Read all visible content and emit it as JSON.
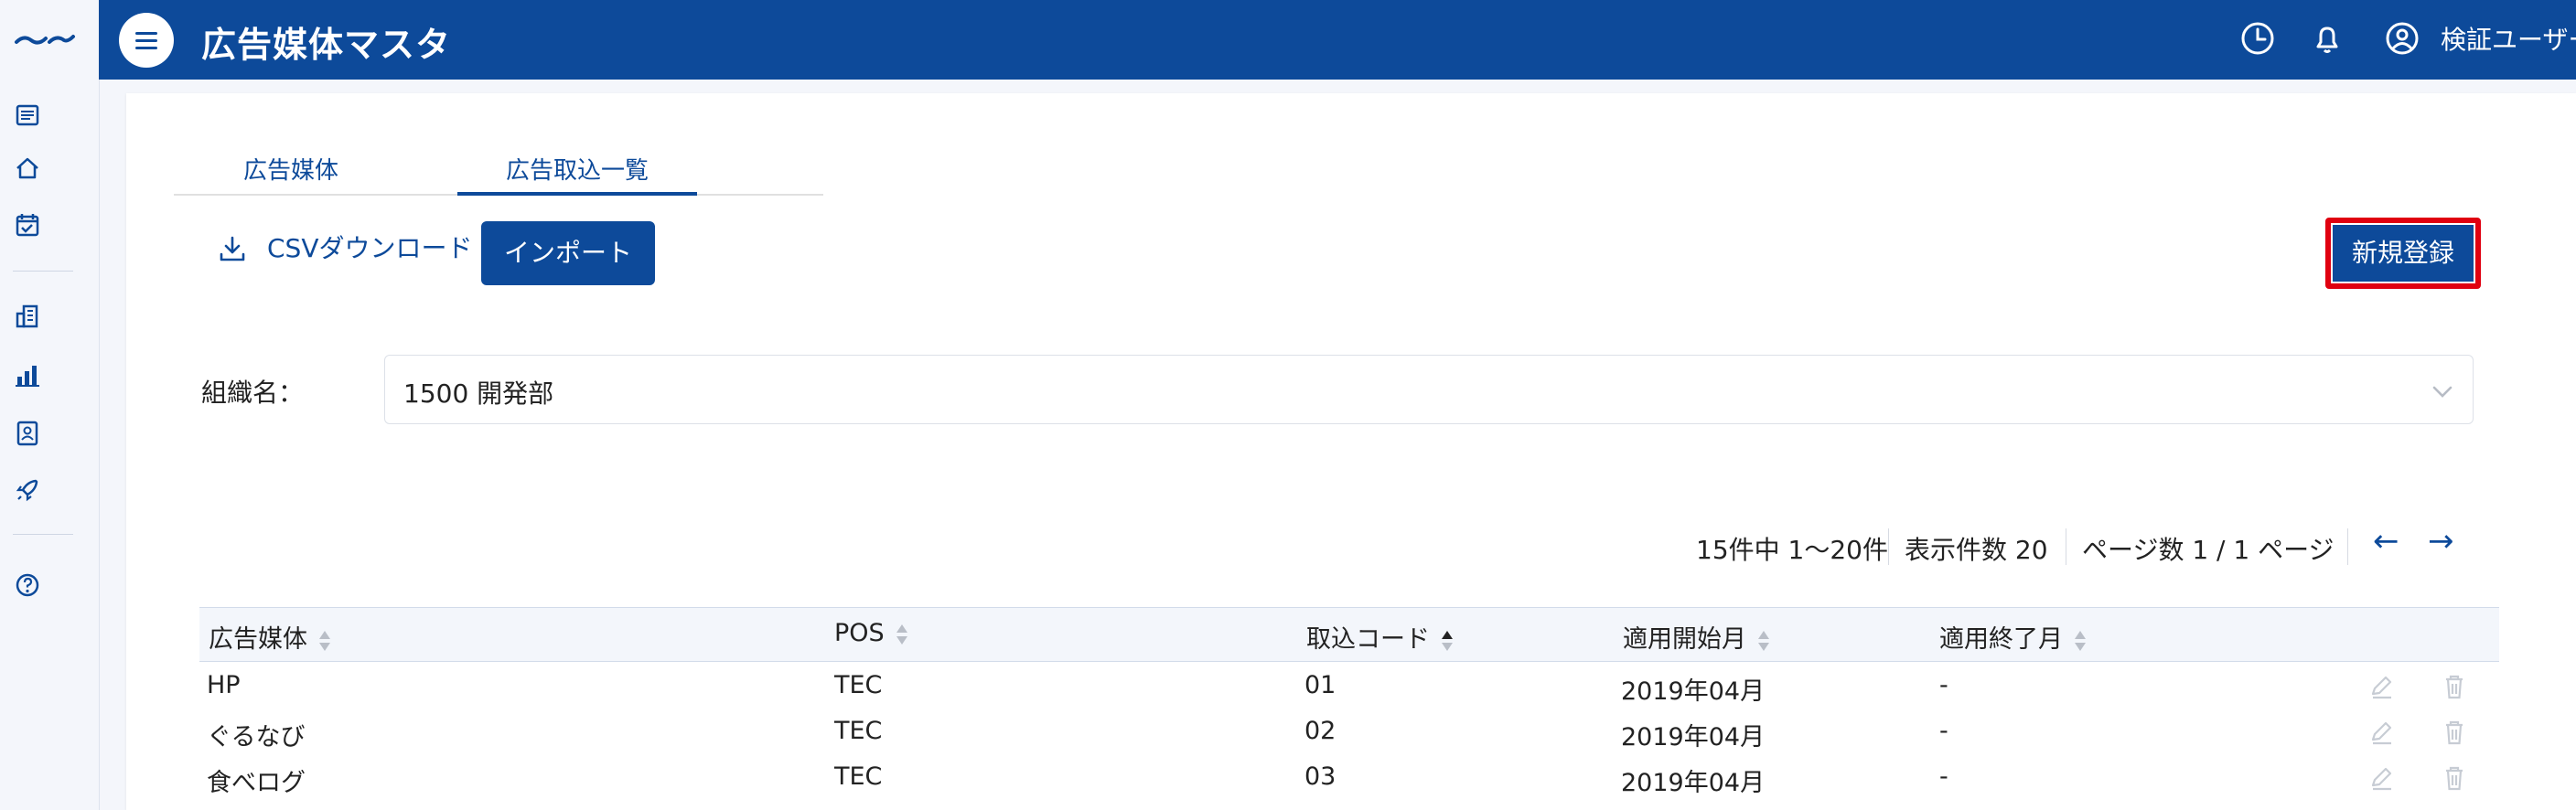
{
  "header": {
    "title": "広告媒体マスタ",
    "user_name": "検証ユーザー"
  },
  "sidebar": {
    "icons": [
      "list-icon",
      "home-icon",
      "calendar-icon",
      "building-icon",
      "bar-chart-icon",
      "contact-card-icon",
      "rocket-icon",
      "help-icon"
    ]
  },
  "tabs": [
    {
      "label": "広告媒体",
      "active": false
    },
    {
      "label": "広告取込一覧",
      "active": true
    }
  ],
  "toolbar": {
    "csv_label": "CSVダウンロード",
    "import_label": "インポート",
    "new_label": "新規登録"
  },
  "filter": {
    "label": "組織名：",
    "value": "1500 開発部"
  },
  "pagination": {
    "summary": "15件中 1〜20件",
    "per_page": "表示件数 20",
    "pages": "ページ数 1 / 1 ページ",
    "prev": "←",
    "next": "→"
  },
  "table": {
    "columns": [
      "広告媒体",
      "POS",
      "取込コード",
      "適用開始月",
      "適用終了月"
    ],
    "rows": [
      {
        "medium": "HP",
        "pos": "TEC",
        "code": "01",
        "start": "2019年04月",
        "end": "-"
      },
      {
        "medium": "ぐるなび",
        "pos": "TEC",
        "code": "02",
        "start": "2019年04月",
        "end": "-"
      },
      {
        "medium": "食べログ",
        "pos": "TEC",
        "code": "03",
        "start": "2019年04月",
        "end": "-"
      }
    ]
  },
  "colors": {
    "primary": "#0d4a9a",
    "highlight": "#e00010"
  }
}
